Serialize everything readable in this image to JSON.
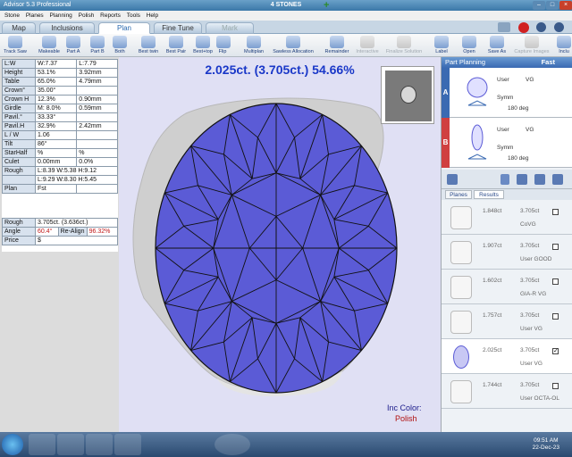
{
  "window": {
    "title": "Advisor 5.3 Professional",
    "center_title": "4 STONES"
  },
  "menu": [
    "Stone",
    "Planes",
    "Planning",
    "Polish",
    "Reports",
    "Tools",
    "Help"
  ],
  "tabs": [
    {
      "label": "Map"
    },
    {
      "label": "Inclusions"
    },
    {
      "label": "Plan"
    },
    {
      "label": "Fine Tune"
    },
    {
      "label": "Mark"
    }
  ],
  "toolbar": [
    {
      "label": "Track Saw"
    },
    {
      "label": "Makeable"
    },
    {
      "label": "Part A"
    },
    {
      "label": "Part B"
    },
    {
      "label": "Both"
    },
    {
      "label": "Best twin"
    },
    {
      "label": "Best Pair"
    },
    {
      "label": "Best+top"
    },
    {
      "label": "Flip"
    },
    {
      "label": "Multiplan"
    },
    {
      "label": "Sawless Allocation"
    },
    {
      "label": "Remainder"
    },
    {
      "label": "Interactive"
    },
    {
      "label": "Finalize Solution"
    },
    {
      "label": "Label"
    },
    {
      "label": "Open"
    },
    {
      "label": "Save As"
    },
    {
      "label": "Capture Images"
    },
    {
      "label": "Inclu"
    }
  ],
  "params": [
    [
      "L:W",
      "W:7.37",
      "L:7.79"
    ],
    [
      "Height",
      "53.1%",
      "3.92mm"
    ],
    [
      "Table",
      "65.0%",
      "4.79mm"
    ],
    [
      "Crown°",
      "35.00°",
      ""
    ],
    [
      "Crown H",
      "12.3%",
      "0.90mm"
    ],
    [
      "Girdle",
      "M: 8.0%",
      "0.59mm"
    ],
    [
      "Pavil.°",
      "33.33°",
      ""
    ],
    [
      "Pavil.H",
      "32.9%",
      "2.42mm"
    ],
    [
      "L / W",
      "1.06",
      ""
    ],
    [
      "Tilt",
      "86°",
      ""
    ],
    [
      "StarHalf",
      "%",
      "%"
    ],
    [
      "Culet",
      "0.00mm",
      "0.0%"
    ],
    [
      "Rough",
      "L:8.39 W:5.38 H:9.12",
      ""
    ],
    [
      "",
      "L:9.29 W:8.30 H:5.45",
      ""
    ],
    [
      "Plan",
      "Fst",
      ""
    ]
  ],
  "summary": {
    "rough_label": "Rough",
    "rough_val": "3.705ct. (3.636ct.)",
    "angle_label": "Angle",
    "angle_val": "60.4°",
    "realign_label": "Re-Align",
    "realign_val": "96.32%",
    "price_label": "Price",
    "price_val": "$"
  },
  "headline": "2.025ct. (3.705ct.) 54.66%",
  "inc_color": {
    "label": "Inc Color:",
    "value": "Polish"
  },
  "part_planning": {
    "title": "Part Planning",
    "mode": "Fast",
    "parts": [
      {
        "tab": "A",
        "user": "User",
        "grade": "VG",
        "symm": "Symm",
        "deg": "180 deg"
      },
      {
        "tab": "B",
        "user": "User",
        "grade": "VG",
        "symm": "Symm",
        "deg": "180 deg"
      }
    ],
    "subtabs": [
      "Planes",
      "Results"
    ],
    "results": [
      {
        "ct": "1.848ct",
        "total": "3.705ct",
        "label": "CoVG",
        "checked": false
      },
      {
        "ct": "1.907ct",
        "total": "3.705ct",
        "label": "User GOOD",
        "checked": false
      },
      {
        "ct": "1.602ct",
        "total": "3.705ct",
        "label": "GIA-R VG",
        "checked": false
      },
      {
        "ct": "1.757ct",
        "total": "3.705ct",
        "label": "User VG",
        "checked": false
      },
      {
        "ct": "2.025ct",
        "total": "3.705ct",
        "label": "User VG",
        "checked": true
      },
      {
        "ct": "1.744ct",
        "total": "3.705ct",
        "label": "User OCTA-OL",
        "checked": false
      }
    ]
  },
  "taskbar": {
    "time": "09:51 AM",
    "date": "22-Dec-23"
  },
  "colors": {
    "gem": "#5b5bd6",
    "headline": "#1a38c8",
    "accent": "#c01818"
  }
}
